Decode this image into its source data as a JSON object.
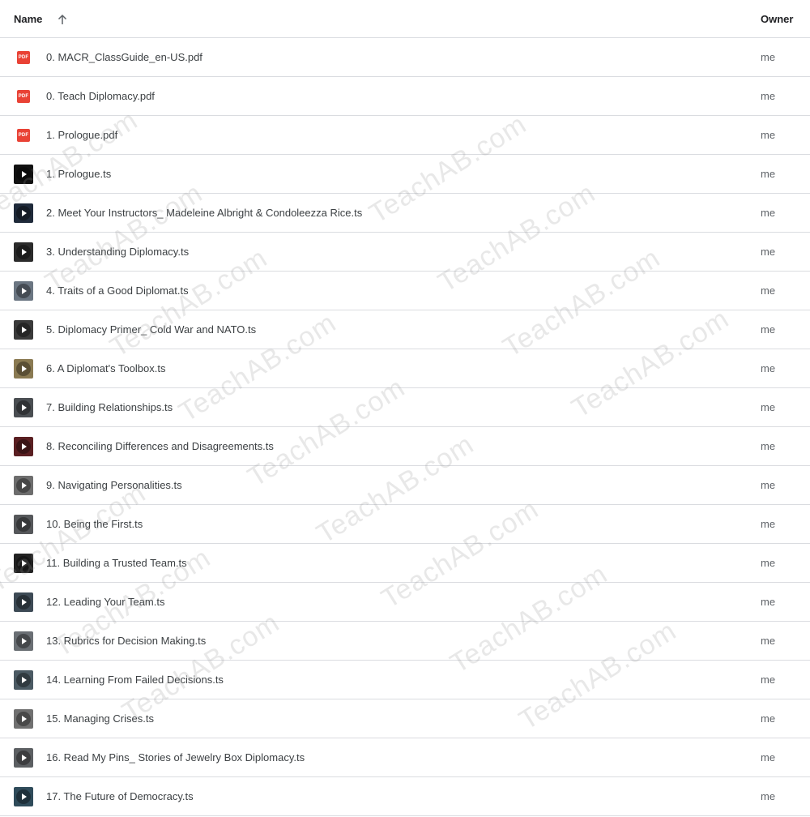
{
  "header": {
    "name_label": "Name",
    "owner_label": "Owner",
    "sort_icon": "arrow-up-icon"
  },
  "watermark": "TeachAB.com",
  "colors": {
    "pdf_red": "#e94235",
    "divider": "#dadce0",
    "text": "#3c4043"
  },
  "files": [
    {
      "name": "0. MACR_ClassGuide_en-US.pdf",
      "owner": "me",
      "type": "pdf",
      "icon": "pdf-icon",
      "thumb": "#e94235"
    },
    {
      "name": "0. Teach Diplomacy.pdf",
      "owner": "me",
      "type": "pdf",
      "icon": "pdf-icon",
      "thumb": "#e94235"
    },
    {
      "name": "1. Prologue.pdf",
      "owner": "me",
      "type": "pdf",
      "icon": "pdf-icon",
      "thumb": "#e94235"
    },
    {
      "name": "1. Prologue.ts",
      "owner": "me",
      "type": "video",
      "icon": "video-thumbnail-icon",
      "thumb": "#111111"
    },
    {
      "name": "2. Meet Your Instructors_ Madeleine Albright & Condoleezza Rice.ts",
      "owner": "me",
      "type": "video",
      "icon": "video-thumbnail-icon",
      "thumb": "#1f2a3a"
    },
    {
      "name": "3. Understanding Diplomacy.ts",
      "owner": "me",
      "type": "video",
      "icon": "video-thumbnail-icon",
      "thumb": "#2b2b2b"
    },
    {
      "name": "4. Traits of a Good Diplomat.ts",
      "owner": "me",
      "type": "video",
      "icon": "video-thumbnail-icon",
      "thumb": "#6b7682"
    },
    {
      "name": "5. Diplomacy Primer_ Cold War and NATO.ts",
      "owner": "me",
      "type": "video",
      "icon": "video-thumbnail-icon",
      "thumb": "#3a3a3a"
    },
    {
      "name": "6. A Diplomat's Toolbox.ts",
      "owner": "me",
      "type": "video",
      "icon": "video-thumbnail-icon",
      "thumb": "#8a7a52"
    },
    {
      "name": "7. Building Relationships.ts",
      "owner": "me",
      "type": "video",
      "icon": "video-thumbnail-icon",
      "thumb": "#4a4e52"
    },
    {
      "name": "8. Reconciling Differences and Disagreements.ts",
      "owner": "me",
      "type": "video",
      "icon": "video-thumbnail-icon",
      "thumb": "#5a1f22"
    },
    {
      "name": "9. Navigating Personalities.ts",
      "owner": "me",
      "type": "video",
      "icon": "video-thumbnail-icon",
      "thumb": "#6d6d6d"
    },
    {
      "name": "10. Being the First.ts",
      "owner": "me",
      "type": "video",
      "icon": "video-thumbnail-icon",
      "thumb": "#55575a"
    },
    {
      "name": "11. Building a Trusted Team.ts",
      "owner": "me",
      "type": "video",
      "icon": "video-thumbnail-icon",
      "thumb": "#222222"
    },
    {
      "name": "12. Leading Your Team.ts",
      "owner": "me",
      "type": "video",
      "icon": "video-thumbnail-icon",
      "thumb": "#3d4a55"
    },
    {
      "name": "13. Rubrics for Decision Making.ts",
      "owner": "me",
      "type": "video",
      "icon": "video-thumbnail-icon",
      "thumb": "#6a6f74"
    },
    {
      "name": "14. Learning From Failed Decisions.ts",
      "owner": "me",
      "type": "video",
      "icon": "video-thumbnail-icon",
      "thumb": "#4b5a63"
    },
    {
      "name": "15. Managing Crises.ts",
      "owner": "me",
      "type": "video",
      "icon": "video-thumbnail-icon",
      "thumb": "#707070"
    },
    {
      "name": "16. Read My Pins_ Stories of Jewelry Box Diplomacy.ts",
      "owner": "me",
      "type": "video",
      "icon": "video-thumbnail-icon",
      "thumb": "#5c5f62"
    },
    {
      "name": "17. The Future of Democracy.ts",
      "owner": "me",
      "type": "video",
      "icon": "video-thumbnail-icon",
      "thumb": "#2f4b5a"
    }
  ]
}
